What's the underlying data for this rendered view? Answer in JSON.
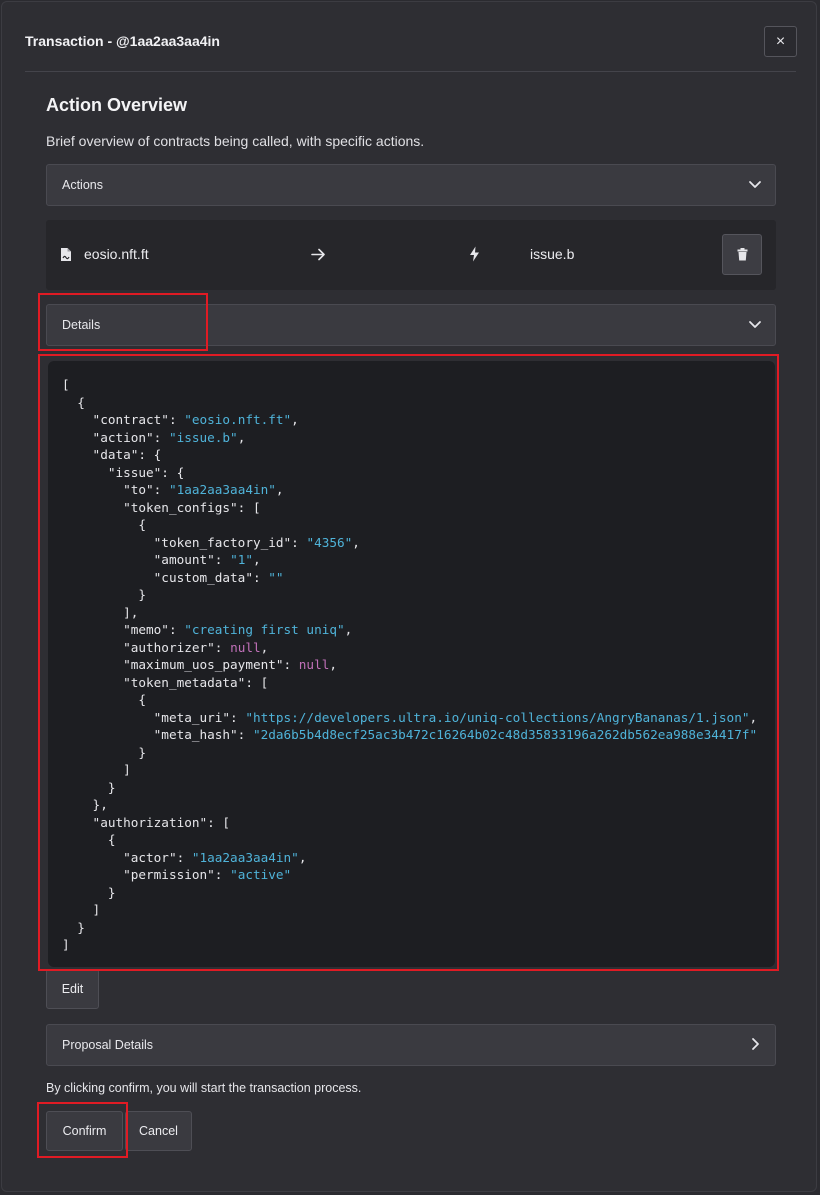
{
  "modal": {
    "title": "Transaction - @1aa2aa3aa4in",
    "close_label": "×"
  },
  "overview": {
    "title": "Action Overview",
    "description": "Brief overview of contracts being called, with specific actions."
  },
  "actions_accordion": {
    "label": "Actions"
  },
  "action_row": {
    "contract": "eosio.nft.ft",
    "arrow": "→",
    "action": "issue.b"
  },
  "details_accordion": {
    "label": "Details"
  },
  "json_lines": [
    [
      [
        "k",
        "["
      ]
    ],
    [
      [
        "k",
        "  {"
      ]
    ],
    [
      [
        "k",
        "    \"contract\": "
      ],
      [
        "s",
        "\"eosio.nft.ft\""
      ],
      [
        "k",
        ","
      ]
    ],
    [
      [
        "k",
        "    \"action\": "
      ],
      [
        "s",
        "\"issue.b\""
      ],
      [
        "k",
        ","
      ]
    ],
    [
      [
        "k",
        "    \"data\": {"
      ]
    ],
    [
      [
        "k",
        "      \"issue\": {"
      ]
    ],
    [
      [
        "k",
        "        \"to\": "
      ],
      [
        "s",
        "\"1aa2aa3aa4in\""
      ],
      [
        "k",
        ","
      ]
    ],
    [
      [
        "k",
        "        \"token_configs\": ["
      ]
    ],
    [
      [
        "k",
        "          {"
      ]
    ],
    [
      [
        "k",
        "            \"token_factory_id\": "
      ],
      [
        "s",
        "\"4356\""
      ],
      [
        "k",
        ","
      ]
    ],
    [
      [
        "k",
        "            \"amount\": "
      ],
      [
        "s",
        "\"1\""
      ],
      [
        "k",
        ","
      ]
    ],
    [
      [
        "k",
        "            \"custom_data\": "
      ],
      [
        "s",
        "\"\""
      ]
    ],
    [
      [
        "k",
        "          }"
      ]
    ],
    [
      [
        "k",
        "        ],"
      ]
    ],
    [
      [
        "k",
        "        \"memo\": "
      ],
      [
        "s",
        "\"creating first uniq\""
      ],
      [
        "k",
        ","
      ]
    ],
    [
      [
        "k",
        "        \"authorizer\": "
      ],
      [
        "n",
        "null"
      ],
      [
        "k",
        ","
      ]
    ],
    [
      [
        "k",
        "        \"maximum_uos_payment\": "
      ],
      [
        "n",
        "null"
      ],
      [
        "k",
        ","
      ]
    ],
    [
      [
        "k",
        "        \"token_metadata\": ["
      ]
    ],
    [
      [
        "k",
        "          {"
      ]
    ],
    [
      [
        "k",
        "            \"meta_uri\": "
      ],
      [
        "s",
        "\"https://developers.ultra.io/uniq-collections/AngryBananas/1.json\""
      ],
      [
        "k",
        ","
      ]
    ],
    [
      [
        "k",
        "            \"meta_hash\": "
      ],
      [
        "s",
        "\"2da6b5b4d8ecf25ac3b472c16264b02c48d35833196a262db562ea988e34417f\""
      ]
    ],
    [
      [
        "k",
        "          }"
      ]
    ],
    [
      [
        "k",
        "        ]"
      ]
    ],
    [
      [
        "k",
        "      }"
      ]
    ],
    [
      [
        "k",
        "    },"
      ]
    ],
    [
      [
        "k",
        "    \"authorization\": ["
      ]
    ],
    [
      [
        "k",
        "      {"
      ]
    ],
    [
      [
        "k",
        "        \"actor\": "
      ],
      [
        "s",
        "\"1aa2aa3aa4in\""
      ],
      [
        "k",
        ","
      ]
    ],
    [
      [
        "k",
        "        \"permission\": "
      ],
      [
        "s",
        "\"active\""
      ]
    ],
    [
      [
        "k",
        "      }"
      ]
    ],
    [
      [
        "k",
        "    ]"
      ]
    ],
    [
      [
        "k",
        "  }"
      ]
    ],
    [
      [
        "k",
        "]"
      ]
    ]
  ],
  "edit_button": {
    "label": "Edit"
  },
  "proposal_accordion": {
    "label": "Proposal Details"
  },
  "confirm_notice": "By clicking confirm, you will start the transaction process.",
  "confirm_button": {
    "label": "Confirm"
  },
  "cancel_button": {
    "label": "Cancel"
  },
  "colors": {
    "background": "#2e2e33",
    "code_background": "#1d1e22",
    "string": "#4fb3d9",
    "null": "#c070b8",
    "highlight": "#e01b24"
  }
}
